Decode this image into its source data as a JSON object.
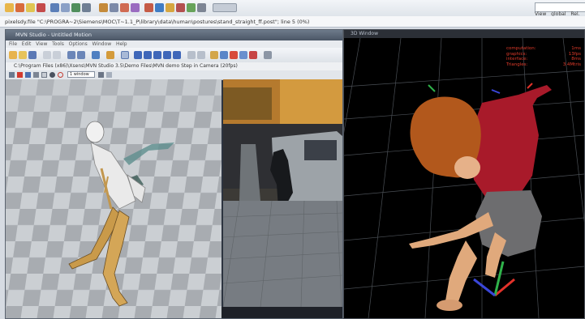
{
  "path_bar": {
    "text": "pixelsdy.file \"C:\\PROGRA~2\\Siemens\\MOC\\T~1.1_P\\library\\data\\human\\postures\\stand_straight_ff.post\"; line 5 (0%)"
  },
  "right_panel": {
    "search_placeholder": "",
    "mode_view": "View",
    "mode_global": "global",
    "mode_other": "Rel."
  },
  "left_window": {
    "title": "MVN Studio - Untitled Motion",
    "menu": [
      "File",
      "Edit",
      "View",
      "Tools",
      "Options",
      "Window",
      "Help"
    ],
    "tab_path": "C:\\Program Files (x86)\\Xsens\\MVN Studio 3.5\\Demo Files\\MVN demo Step in Camera (20fps)",
    "zoom_select": "1 window"
  },
  "right_window": {
    "title": "3D Window",
    "stats": [
      {
        "label": "computation:",
        "value": "1ms"
      },
      {
        "label": "graphics:",
        "value": "13fps"
      },
      {
        "label": "interface:",
        "value": "8ms"
      },
      {
        "label": "Triangles:",
        "value": "3.4Mtris"
      }
    ]
  },
  "colors": {
    "toolbar_bg": "#e4e8ee",
    "floor_light": "#cfd2d6",
    "floor_dark": "#a9adb2",
    "stats_text": "#e03b2a",
    "axis_x": "#e2322a",
    "axis_y": "#2fb24a",
    "axis_z": "#3a46d8"
  }
}
